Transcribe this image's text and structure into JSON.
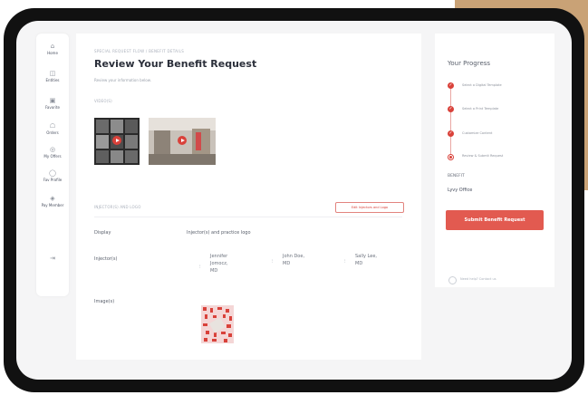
{
  "sidebar": {
    "items": [
      {
        "icon": "home-icon",
        "glyph": "⌂",
        "label": "Home"
      },
      {
        "icon": "entities-icon",
        "glyph": "◫",
        "label": "Entities"
      },
      {
        "icon": "favorite-icon",
        "glyph": "▣",
        "label": "Favorite"
      },
      {
        "icon": "orders-icon",
        "glyph": "☖",
        "label": "Orders"
      },
      {
        "icon": "offers-icon",
        "glyph": "◎",
        "label": "My Offers"
      },
      {
        "icon": "profile-icon",
        "glyph": "◯",
        "label": "Fav Profile"
      },
      {
        "icon": "pay-icon",
        "glyph": "◈",
        "label": "Pay Member"
      },
      {
        "icon": "logout-icon",
        "glyph": "⇥",
        "label": ""
      }
    ]
  },
  "main": {
    "eyebrow": "SPECIAL REQUEST FLOW / BENEFIT DETAILS",
    "title": "Review Your Benefit Request",
    "subtitle": "Review your information below.",
    "videos_label": "VIDEO(S)",
    "injectors_label": "INJECTOR(S) AND LOGO",
    "edit_label": "Edit Injectors and Logo",
    "display_label": "Display",
    "display_value": "Injector(s) and practice logo",
    "injectors_row_label": "Injector(s)",
    "injectors": [
      {
        "line1": "Jennifer",
        "line2": "Jomocz,",
        "line3": "MD"
      },
      {
        "line1": "John Doe,",
        "line2": "MD",
        "line3": ""
      },
      {
        "line1": "Sally Lee,",
        "line2": "MD",
        "line3": ""
      }
    ],
    "images_label": "Image(s)"
  },
  "progress": {
    "title": "Your Progress",
    "steps": [
      {
        "label": "Select a Digital Template",
        "state": "done"
      },
      {
        "label": "Select a Print Template",
        "state": "done"
      },
      {
        "label": "Customize Content",
        "state": "done"
      },
      {
        "label": "Review & Submit Request",
        "state": "current"
      }
    ],
    "benefit_label": "BENEFIT",
    "benefit_value": "Lyvy Office",
    "submit_label": "Submit Benefit Request",
    "help_text": "Need help? Contact us",
    "help_link": "Contact us"
  },
  "colors": {
    "accent": "#e25a50",
    "background_gold": "#c9a276"
  }
}
